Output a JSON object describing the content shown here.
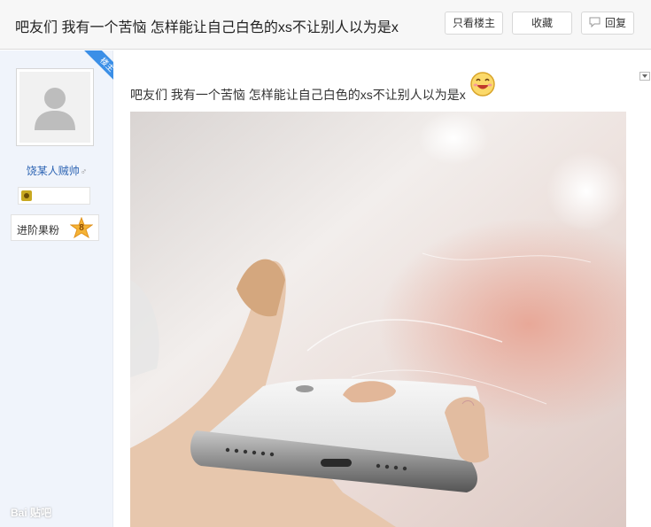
{
  "header": {
    "title": "吧友们 我有一个苦恼 怎样能让自己白色的xs不让别人以为是x",
    "buttons": {
      "only_op": "只看楼主",
      "favorite": "收藏",
      "reply": "回复"
    }
  },
  "author": {
    "op_badge": "楼主",
    "username": "饶某人贼帅",
    "gender_symbol": "♂",
    "level_name": "进阶果粉",
    "level_number": "8"
  },
  "post": {
    "text": "吧友们 我有一个苦恼 怎样能让自己白色的xs不让别人以为是x",
    "emoji": "smile-emoji",
    "image_watermark": "Bai 贴吧"
  },
  "colors": {
    "accent_blue": "#3b8fe7",
    "username_blue": "#2d64b3",
    "sidebar_bg": "#f0f4fb"
  }
}
